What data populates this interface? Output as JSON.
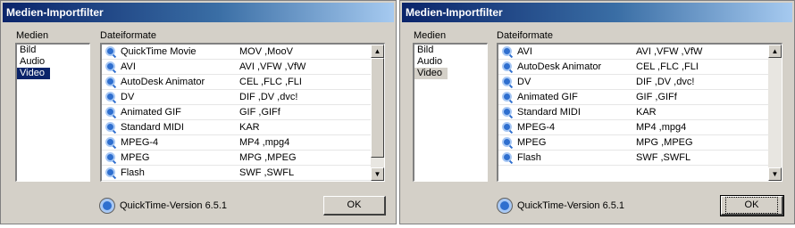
{
  "dialogs": [
    {
      "title": "Medien-Importfilter",
      "media_label": "Medien",
      "formats_label": "Dateiformate",
      "media_items": [
        "Bild",
        "Audio",
        "Video"
      ],
      "selected_media": "Video",
      "formats": [
        {
          "name": "QuickTime Movie",
          "ext": "MOV ,MooV"
        },
        {
          "name": "AVI",
          "ext": "AVI ,VFW ,VfW"
        },
        {
          "name": "AutoDesk Animator",
          "ext": "CEL ,FLC ,FLI"
        },
        {
          "name": "DV",
          "ext": "DIF ,DV ,dvc!"
        },
        {
          "name": "Animated GIF",
          "ext": "GIF ,GIFf"
        },
        {
          "name": "Standard MIDI",
          "ext": "KAR"
        },
        {
          "name": "MPEG-4",
          "ext": "MP4 ,mpg4"
        },
        {
          "name": "MPEG",
          "ext": "MPG ,MPEG"
        },
        {
          "name": "Flash",
          "ext": "SWF ,SWFL"
        }
      ],
      "version_text": "QuickTime-Version 6.5.1",
      "ok_label": "OK"
    },
    {
      "title": "Medien-Importfilter",
      "media_label": "Medien",
      "formats_label": "Dateiformate",
      "media_items": [
        "Bild",
        "Audio",
        "Video"
      ],
      "selected_media": "Video",
      "formats": [
        {
          "name": "AVI",
          "ext": "AVI ,VFW ,VfW"
        },
        {
          "name": "AutoDesk Animator",
          "ext": "CEL ,FLC ,FLI"
        },
        {
          "name": "DV",
          "ext": "DIF ,DV ,dvc!"
        },
        {
          "name": "Animated GIF",
          "ext": "GIF ,GIFf"
        },
        {
          "name": "Standard MIDI",
          "ext": "KAR"
        },
        {
          "name": "MPEG-4",
          "ext": "MP4 ,mpg4"
        },
        {
          "name": "MPEG",
          "ext": "MPG ,MPEG"
        },
        {
          "name": "Flash",
          "ext": "SWF ,SWFL"
        }
      ],
      "version_text": "QuickTime-Version 6.5.1",
      "ok_label": "OK"
    }
  ],
  "icons": {
    "format_icon": "quicktime-icon",
    "footer_icon": "quicktime-icon"
  }
}
